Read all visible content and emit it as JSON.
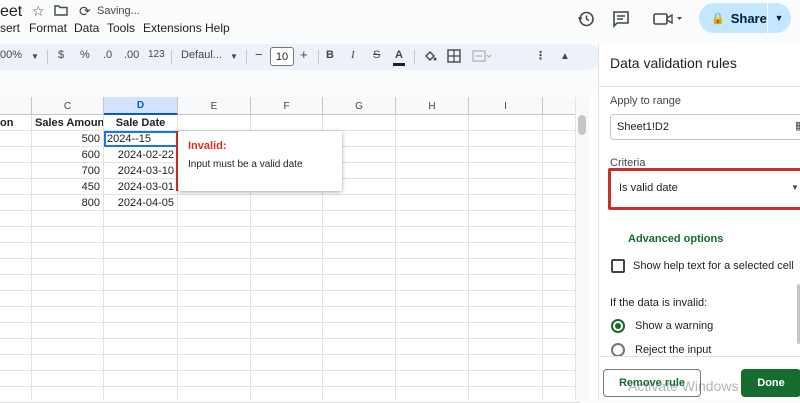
{
  "header": {
    "doc_title": "eet",
    "status": "Saving...",
    "share_label": "Share",
    "icons": [
      "star-icon",
      "move-to-folder-icon",
      "sync-icon",
      "history-icon",
      "comment-icon",
      "video-call-icon"
    ],
    "accent_color": "#c2e7ff"
  },
  "menu": {
    "items": [
      "sert",
      "Format",
      "Data",
      "Tools",
      "Extensions",
      "Help"
    ]
  },
  "toolbar": {
    "zoom": "00%",
    "currency": "$",
    "percent": "%",
    "decrease_decimal": ".0",
    "increase_decimal": ".00",
    "number_format": "123",
    "font": "Defaul...",
    "minus": "−",
    "font_size": "10",
    "plus": "+",
    "bold": "B",
    "italic": "I",
    "text_color": "A"
  },
  "sheet": {
    "columns": [
      "on",
      "C",
      "D",
      "E",
      "F",
      "G",
      "H",
      "I"
    ],
    "active_column": "D",
    "header_row": [
      "on",
      "Sales Amount",
      "Sale Date"
    ],
    "rows": [
      {
        "b": "",
        "c": "500",
        "d": "2024--15"
      },
      {
        "b": "",
        "c": "600",
        "d": "2024-02-22"
      },
      {
        "b": "",
        "c": "700",
        "d": "2024-03-10"
      },
      {
        "b": "",
        "c": "450",
        "d": "2024-03-01"
      },
      {
        "b": "",
        "c": "800",
        "d": "2024-04-05"
      }
    ],
    "invalid_popup": {
      "title": "Invalid:",
      "message": "Input must be a valid date"
    }
  },
  "panel": {
    "title": "Data validation rules",
    "apply_label": "Apply to range",
    "range_value": "Sheet1!D2",
    "criteria_label": "Criteria",
    "criteria_value": "Is valid date",
    "advanced_options": "Advanced options",
    "help_text_label": "Show help text for a selected cell",
    "invalid_heading": "If the data is invalid:",
    "radio_warning": "Show a warning",
    "radio_reject": "Reject the input",
    "remove_rule": "Remove rule",
    "done": "Done",
    "watermark": "Activate Windows"
  }
}
